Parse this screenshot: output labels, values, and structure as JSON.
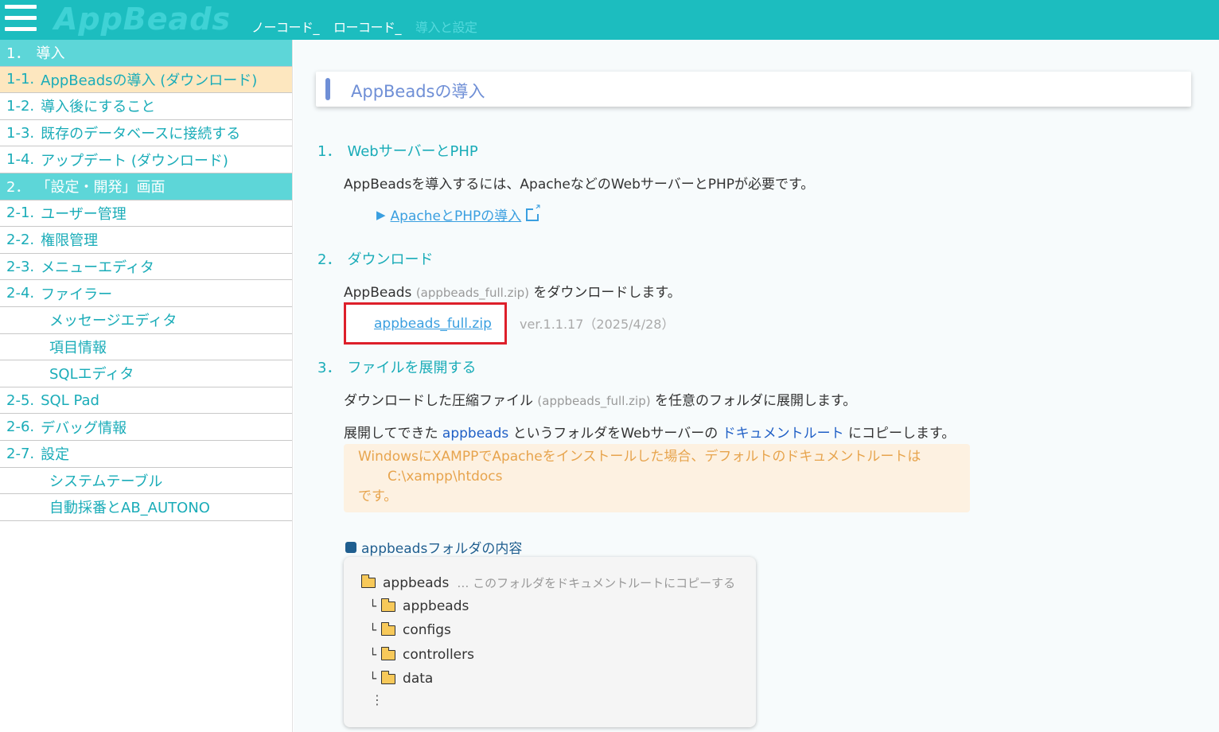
{
  "header": {
    "logo": "AppBeads",
    "nav": [
      {
        "label": "ノーコード_"
      },
      {
        "label": "ローコード_"
      },
      {
        "label": "導入と設定"
      }
    ]
  },
  "sidebar": {
    "items": [
      {
        "num": "1．",
        "label": "導入",
        "type": "section"
      },
      {
        "num": "1-1.",
        "label": "AppBeadsの導入 (ダウンロード)",
        "type": "active"
      },
      {
        "num": "1-2.",
        "label": "導入後にすること",
        "type": "item"
      },
      {
        "num": "1-3.",
        "label": "既存のデータベースに接続する",
        "type": "item"
      },
      {
        "num": "1-4.",
        "label": "アップデート (ダウンロード)",
        "type": "item"
      },
      {
        "num": "2．",
        "label": "「設定・開発」画面",
        "type": "section"
      },
      {
        "num": "2-1.",
        "label": "ユーザー管理",
        "type": "item"
      },
      {
        "num": "2-2.",
        "label": "権限管理",
        "type": "item"
      },
      {
        "num": "2-3.",
        "label": "メニューエディタ",
        "type": "item"
      },
      {
        "num": "2-4.",
        "label": "ファイラー",
        "type": "item"
      },
      {
        "num": "",
        "label": "メッセージエディタ",
        "type": "sub"
      },
      {
        "num": "",
        "label": "項目情報",
        "type": "sub"
      },
      {
        "num": "",
        "label": "SQLエディタ",
        "type": "sub"
      },
      {
        "num": "2-5.",
        "label": "SQL Pad",
        "type": "item"
      },
      {
        "num": "2-6.",
        "label": "デバッグ情報",
        "type": "item"
      },
      {
        "num": "2-7.",
        "label": "設定",
        "type": "item"
      },
      {
        "num": "",
        "label": "システムテーブル",
        "type": "sub"
      },
      {
        "num": "",
        "label": "自動採番とAB_AUTONO",
        "type": "sub"
      }
    ]
  },
  "main": {
    "title": "AppBeadsの導入",
    "s1": {
      "num": "1．",
      "heading": "WebサーバーとPHP",
      "text": "AppBeadsを導入するには、ApacheなどのWebサーバーとPHPが必要です。",
      "link": "ApacheとPHPの導入"
    },
    "s2": {
      "num": "2．",
      "heading": "ダウンロード",
      "text_a": "AppBeads",
      "text_file": "(appbeads_full.zip)",
      "text_b": "をダウンロードします。",
      "download_link": "appbeads_full.zip",
      "version": "ver.1.1.17（2025/4/28）"
    },
    "s3": {
      "num": "3．",
      "heading": "ファイルを展開する",
      "text1_a": "ダウンロードした圧縮ファイル",
      "text1_file": "(appbeads_full.zip)",
      "text1_b": "を任意のフォルダに展開します。",
      "text2_a": "展開してできた",
      "text2_folder": "appbeads",
      "text2_b": "というフォルダをWebサーバーの",
      "text2_docroot": "ドキュメントルート",
      "text2_c": "にコピーします。",
      "note_line1": "WindowsにXAMPPでApacheをインストールした場合、デフォルトのドキュメントルートは",
      "note_line2": "C:\\xampp\\htdocs",
      "note_line3": "です。",
      "folder_heading": "appbeadsフォルダの内容",
      "tree_root": "appbeads",
      "tree_root_note": "… このフォルダをドキュメントルートにコピーする",
      "tree_children": [
        "appbeads",
        "configs",
        "controllers",
        "data"
      ],
      "tree_more": "⋮"
    }
  }
}
